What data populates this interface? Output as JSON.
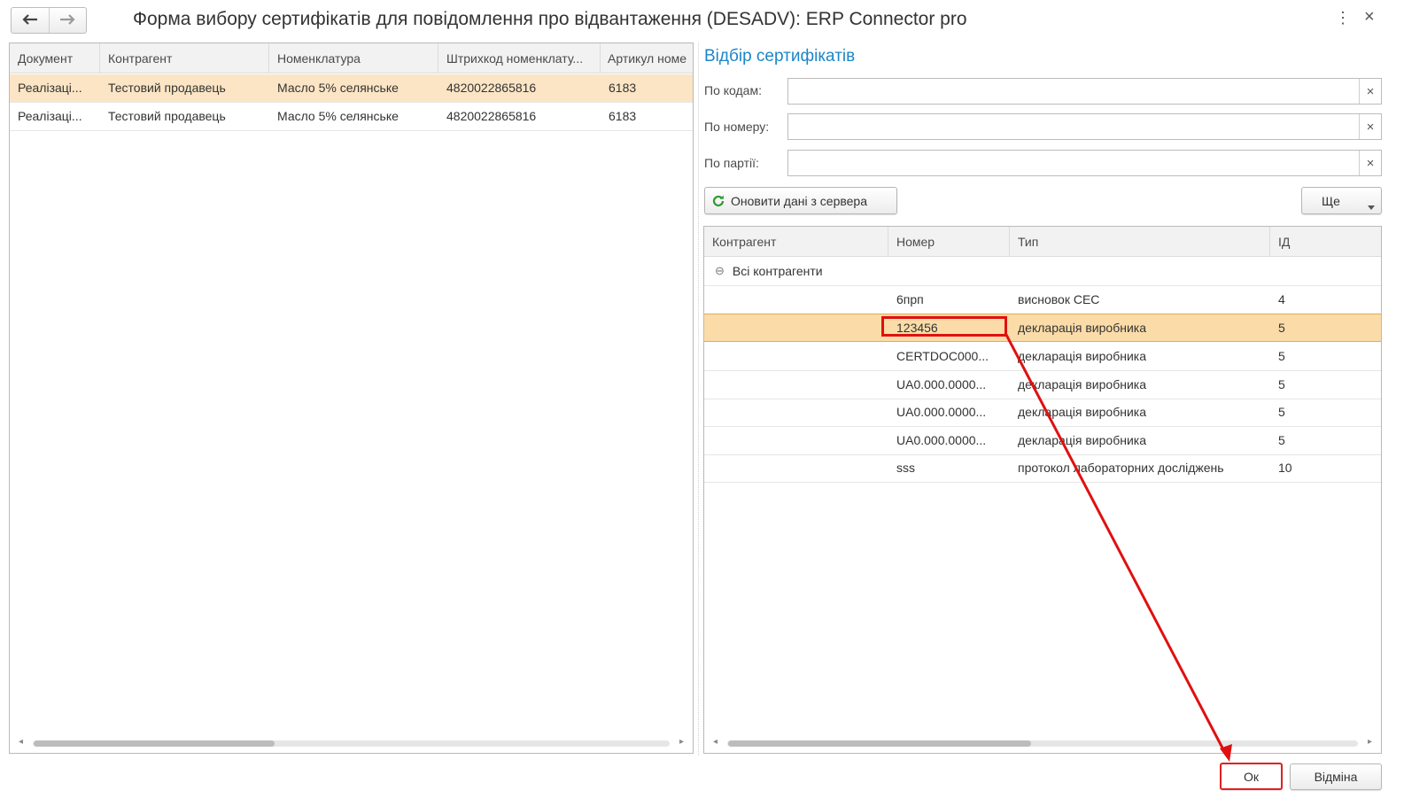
{
  "window": {
    "title": "Форма вибору сертифікатів для повідомлення про відвантаження (DESADV): ERP Connector pro",
    "icons": {
      "back": "arrow-left-icon",
      "forward": "arrow-right-icon",
      "menu": "more-vertical-icon",
      "close": "close-icon"
    },
    "menu_glyph": "⋮",
    "close_glyph": "×"
  },
  "left_table": {
    "columns": [
      "Документ",
      "Контрагент",
      "Номенклатура",
      "Штрихкод номенклату...",
      "Артикул номе"
    ],
    "rows": [
      [
        "Реалізаці...",
        "Тестовий продавець",
        "Масло 5% селянське",
        "4820022865816",
        "6183"
      ],
      [
        "Реалізаці...",
        "Тестовий продавець",
        "Масло 5% селянське",
        "4820022865816",
        "6183"
      ]
    ],
    "selected_row": 0
  },
  "filters": {
    "title": "Відбір сертифікатів",
    "by_codes_label": "По кодам:",
    "by_number_label": "По номеру:",
    "by_batch_label": "По партії:",
    "by_codes_value": "",
    "by_number_value": "",
    "by_batch_value": "",
    "clear_glyph": "×"
  },
  "toolbar": {
    "refresh_label": "Оновити дані з сервера",
    "refresh_icon": "refresh-icon",
    "more_label": "Ще",
    "more_icon": "caret-down-icon"
  },
  "cert_table": {
    "columns": [
      "Контрагент",
      "Номер",
      "Тип",
      "ІД"
    ],
    "group_label": "Всі контрагенти",
    "group_toggle": "⊖",
    "rows": [
      [
        "",
        "6прп",
        "висновок СЕС",
        "4"
      ],
      [
        "",
        "123456",
        "декларація виробника",
        "5"
      ],
      [
        "",
        "CERTDOC000...",
        "декларація виробника",
        "5"
      ],
      [
        "",
        "UA0.000.0000...",
        "декларація виробника",
        "5"
      ],
      [
        "",
        "UA0.000.0000...",
        "декларація виробника",
        "5"
      ],
      [
        "",
        "UA0.000.0000...",
        "декларація виробника",
        "5"
      ],
      [
        "",
        "sss",
        "протокол лабораторних досліджень",
        "10"
      ]
    ],
    "selected_row": 1
  },
  "footer": {
    "ok_label": "Ок",
    "cancel_label": "Відміна"
  },
  "colors": {
    "accent_blue": "#1c86c8",
    "selection": "#fbdca8",
    "annotation_red": "#e01010",
    "refresh_green": "#2e9b2e"
  }
}
